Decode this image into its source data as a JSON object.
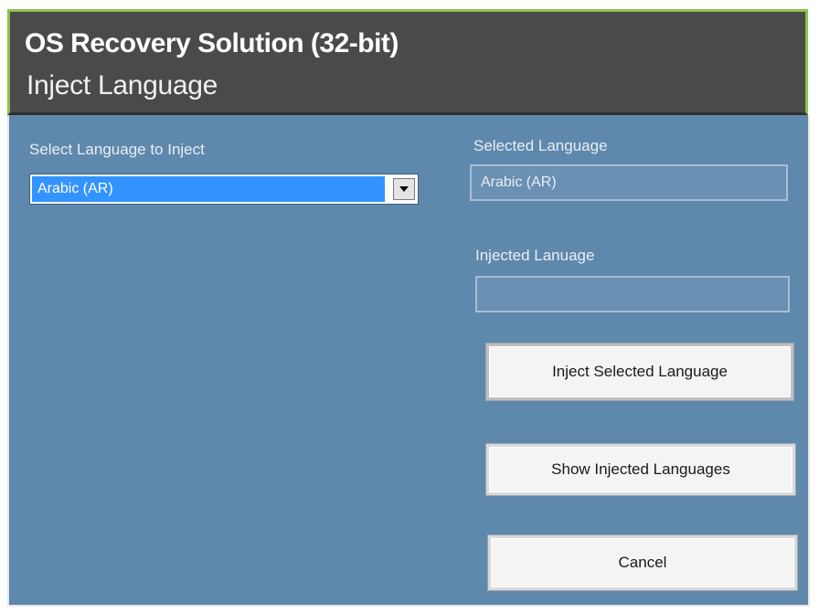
{
  "header": {
    "title": "OS Recovery Solution (32-bit)",
    "subtitle": "Inject Language"
  },
  "left": {
    "select_label": "Select Language to Inject",
    "selected_value": "Arabic (AR)",
    "dropdown_icon": "chevron-down-icon"
  },
  "right": {
    "selected_label": "Selected Language",
    "selected_value": "Arabic (AR)",
    "injected_label": "Injected Lanuage",
    "injected_value": ""
  },
  "buttons": {
    "inject": "Inject Selected Language",
    "show": "Show Injected Languages",
    "cancel": "Cancel"
  },
  "colors": {
    "header_bg": "#4a4a4a",
    "panel_bg": "#5f88ad",
    "selection": "#3394ff",
    "accent_border": "#8bc34a"
  }
}
